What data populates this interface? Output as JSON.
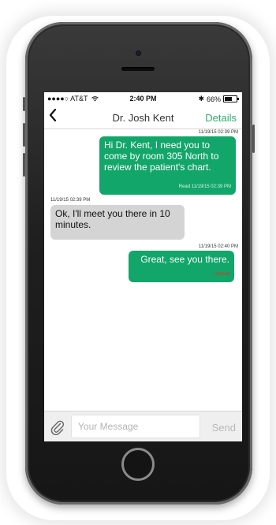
{
  "status_bar": {
    "carrier": "●●●●○ AT&T",
    "time": "2:40 PM",
    "bluetooth": "✱",
    "battery": "66%",
    "battery_level": 0.66
  },
  "nav": {
    "back_icon": "chevron-left-icon",
    "title": "Dr. Josh Kent",
    "details_label": "Details",
    "accent_color": "#2daf6b"
  },
  "messages": [
    {
      "direction": "outgoing",
      "timestamp": "11/19/15 02:39 PM",
      "text": "Hi Dr. Kent, I need you to come by room 305 North to review the patient's chart.",
      "receipt": "Read 11/19/15 02:39 PM"
    },
    {
      "direction": "incoming",
      "timestamp": "11/19/15 02:39 PM",
      "text": "Ok, I'll meet you there in 10 minutes."
    },
    {
      "direction": "outgoing",
      "timestamp": "11/19/15 02:40 PM",
      "text": "Great, see you there.",
      "receipt": "Unread"
    }
  ],
  "colors": {
    "outgoing_bubble": "#13a66a",
    "incoming_bubble": "#d4d4d4",
    "read_receipt": "#d7f5e6",
    "unread_receipt": "#e0301e"
  },
  "composer": {
    "attach_icon": "paperclip-icon",
    "placeholder": "Your Message",
    "send_label": "Send"
  }
}
